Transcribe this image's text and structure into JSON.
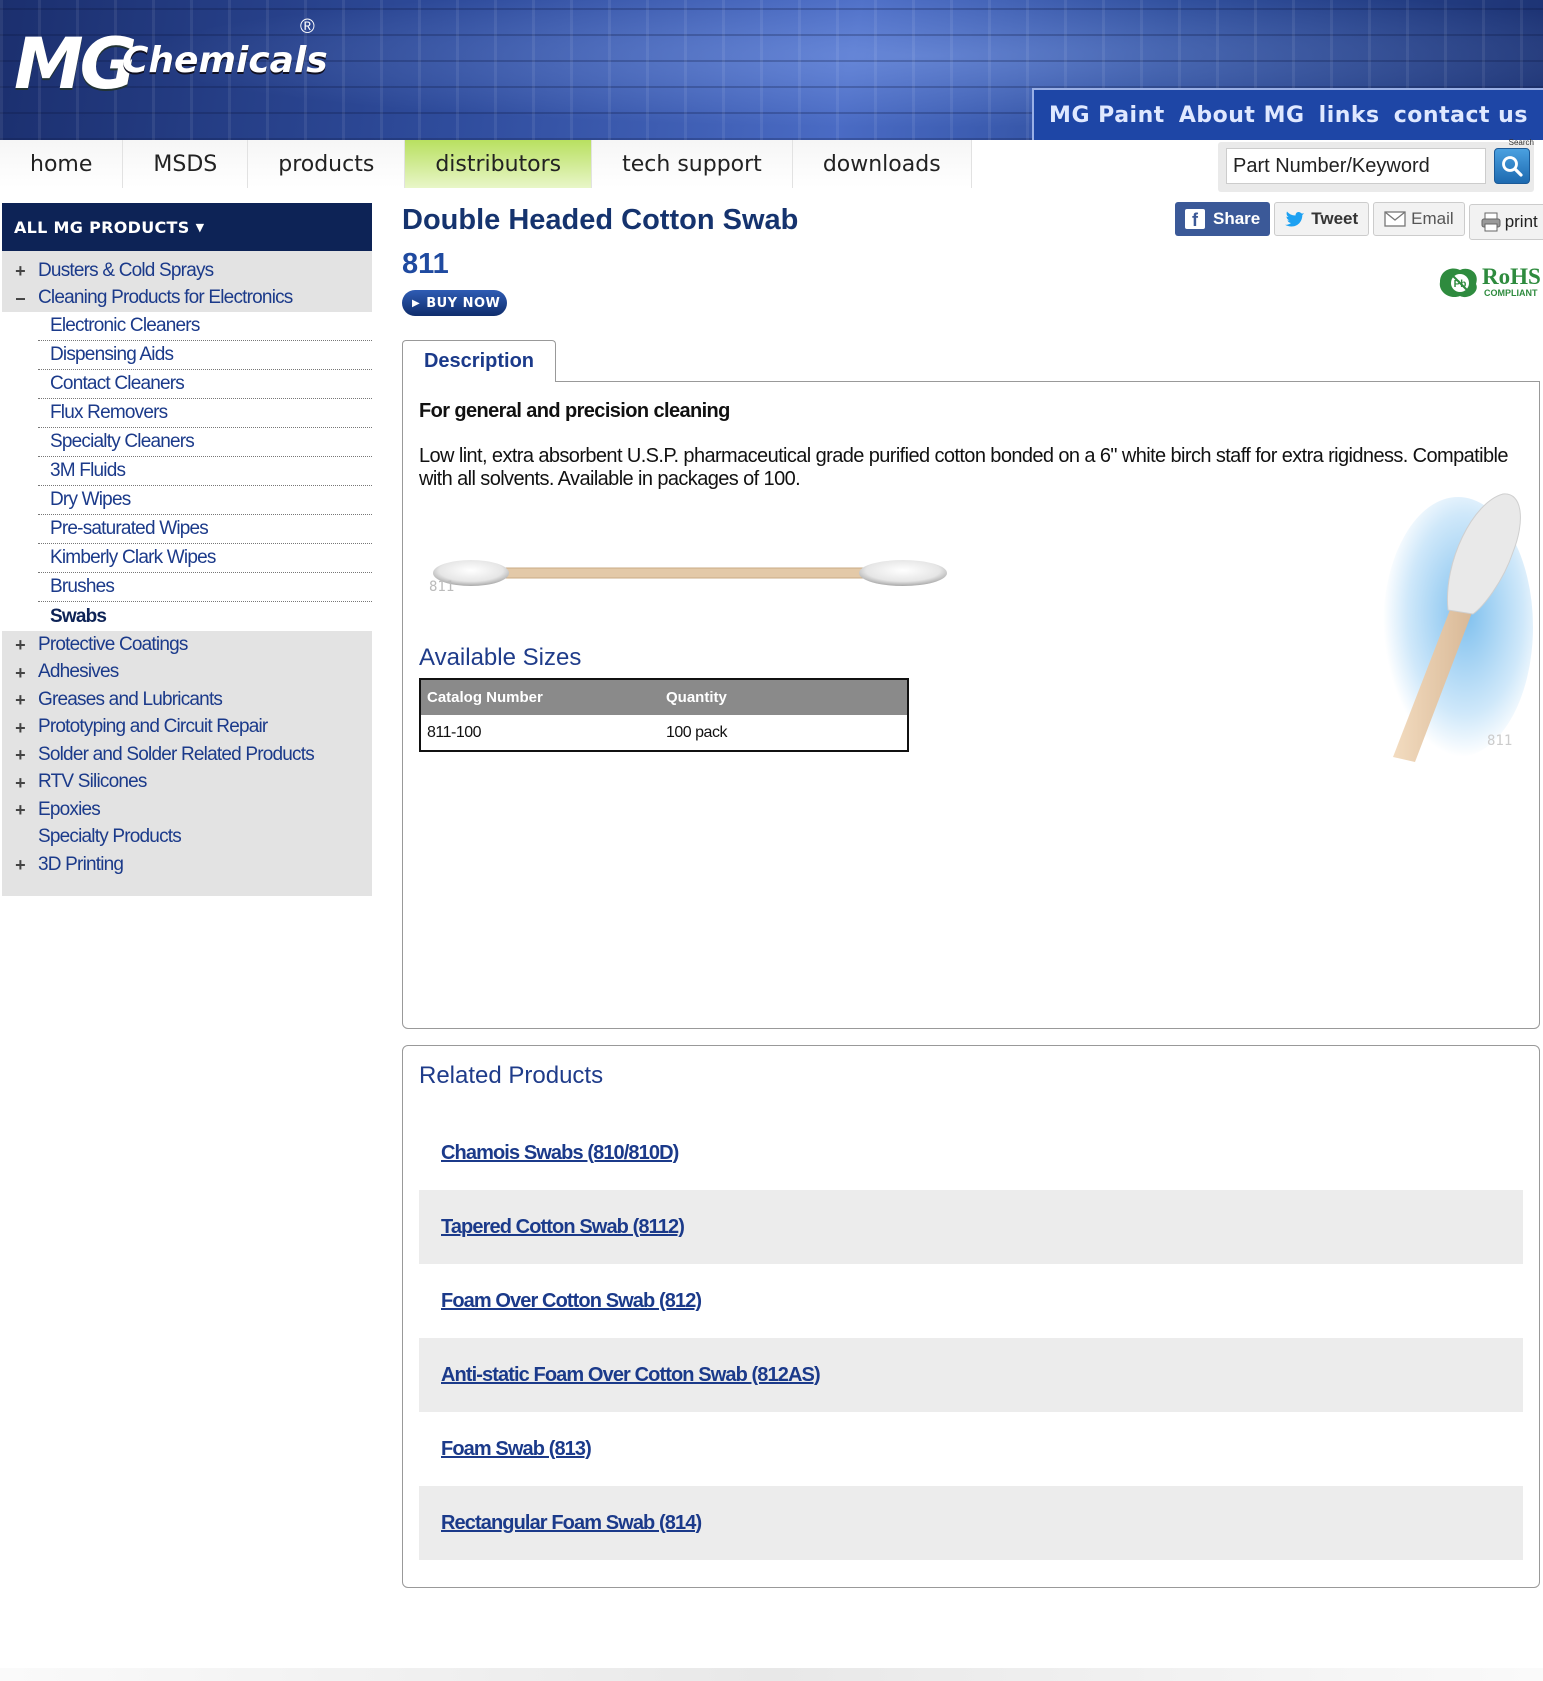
{
  "brand": {
    "logo_mg": "MG",
    "logo_chemicals": "Chemicals",
    "registered": "®"
  },
  "top_nav": [
    "MG Paint",
    "About MG",
    "links",
    "contact us"
  ],
  "main_nav": {
    "items": [
      "home",
      "MSDS",
      "products",
      "distributors",
      "tech support",
      "downloads"
    ],
    "active": "distributors"
  },
  "search": {
    "value": "Part Number/Keyword",
    "label": "Search",
    "icon": "search-icon"
  },
  "sidebar": {
    "header": "ALL MG PRODUCTS",
    "categories_top": [
      "Dusters & Cold Sprays",
      "Cleaning Products for Electronics"
    ],
    "subcategories": [
      "Electronic Cleaners",
      "Dispensing Aids",
      "Contact Cleaners",
      "Flux Removers",
      "Specialty Cleaners",
      "3M Fluids",
      "Dry Wipes",
      "Pre-saturated Wipes",
      "Kimberly Clark Wipes",
      "Brushes",
      "Swabs"
    ],
    "categories_bottom": [
      "Protective Coatings",
      "Adhesives",
      "Greases and Lubricants",
      "Prototyping and Circuit Repair",
      "Solder and Solder Related Products",
      "RTV Silicones",
      "Epoxies",
      "Specialty Products",
      "3D Printing"
    ]
  },
  "product": {
    "title": "Double Headed Cotton Swab",
    "number": "811",
    "buy_now": "BUY NOW"
  },
  "social": {
    "share": "Share",
    "tweet": "Tweet",
    "email": "Email",
    "print": "print"
  },
  "rohs": {
    "main": "RoHS",
    "sub": "COMPLIANT"
  },
  "description": {
    "tab": "Description",
    "heading": "For general and precision cleaning",
    "text": "Low lint, extra absorbent U.S.P. pharmaceutical grade purified cotton bonded on a 6\" white birch staff for extra rigidness. Compatible with all solvents. Available in packages of 100.",
    "image_caption": "811"
  },
  "sizes": {
    "heading": "Available Sizes",
    "columns": [
      "Catalog Number",
      "Quantity"
    ],
    "rows": [
      [
        "811-100",
        "100 pack"
      ]
    ]
  },
  "related": {
    "heading": "Related Products",
    "items": [
      "Chamois Swabs (810/810D)",
      "Tapered Cotton Swab (8112)",
      "Foam Over Cotton Swab (812)",
      "Anti-static Foam Over Cotton Swab (812AS)",
      "Foam Swab (813)",
      "Rectangular Foam Swab (814)"
    ]
  },
  "colors": {
    "navy": "#0d2356",
    "link": "#1b3a8a",
    "active_tab": "#b8e060",
    "facebook": "#3b5998"
  }
}
